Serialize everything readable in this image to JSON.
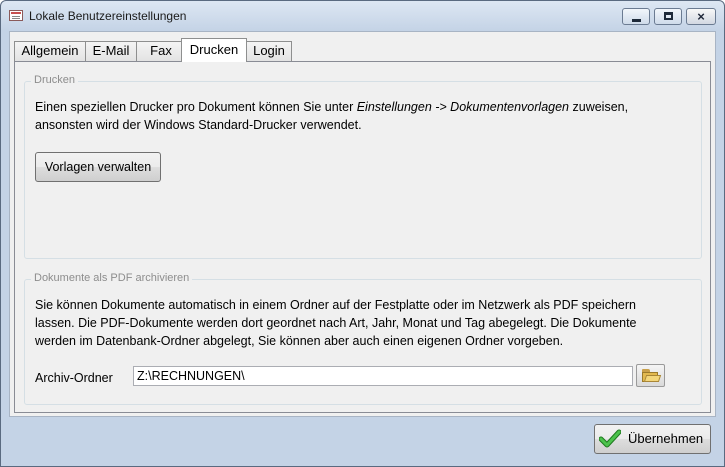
{
  "window": {
    "title": "Lokale Benutzereinstellungen",
    "controls": {
      "minimize": "minimize",
      "maximize": "maximize",
      "close": "×"
    }
  },
  "tabs": [
    {
      "label": "Allgemein"
    },
    {
      "label": "E-Mail"
    },
    {
      "label": "Fax"
    },
    {
      "label": "Drucken",
      "active": true
    },
    {
      "label": "Login"
    }
  ],
  "drucken_group": {
    "label": "Drucken",
    "text_before": "Einen speziellen Drucker pro Dokument können Sie unter ",
    "text_italic": "Einstellungen -> Dokumentenvorlagen",
    "text_after": " zuweisen,",
    "text_line2": "ansonsten wird der Windows Standard-Drucker verwendet.",
    "button_label": "Vorlagen verwalten"
  },
  "pdf_group": {
    "label": "Dokumente als PDF archivieren",
    "line1": "Sie können Dokumente automatisch in einem Ordner auf der Festplatte oder im Netzwerk als PDF speichern",
    "line2": "lassen. Die PDF-Dokumente werden dort geordnet nach Art, Jahr, Monat und Tag abegelegt. Die Dokumente",
    "line3": "werden im Datenbank-Ordner abgelegt, Sie können aber auch einen eigenen Ordner vorgeben.",
    "folder_label": "Archiv-Ordner",
    "folder_value": "Z:\\RECHNUNGEN\\"
  },
  "footer": {
    "ok_label": "Übernehmen"
  },
  "colors": {
    "check_green": "#2e9a2e",
    "title_bar": "#c4d3e6"
  }
}
